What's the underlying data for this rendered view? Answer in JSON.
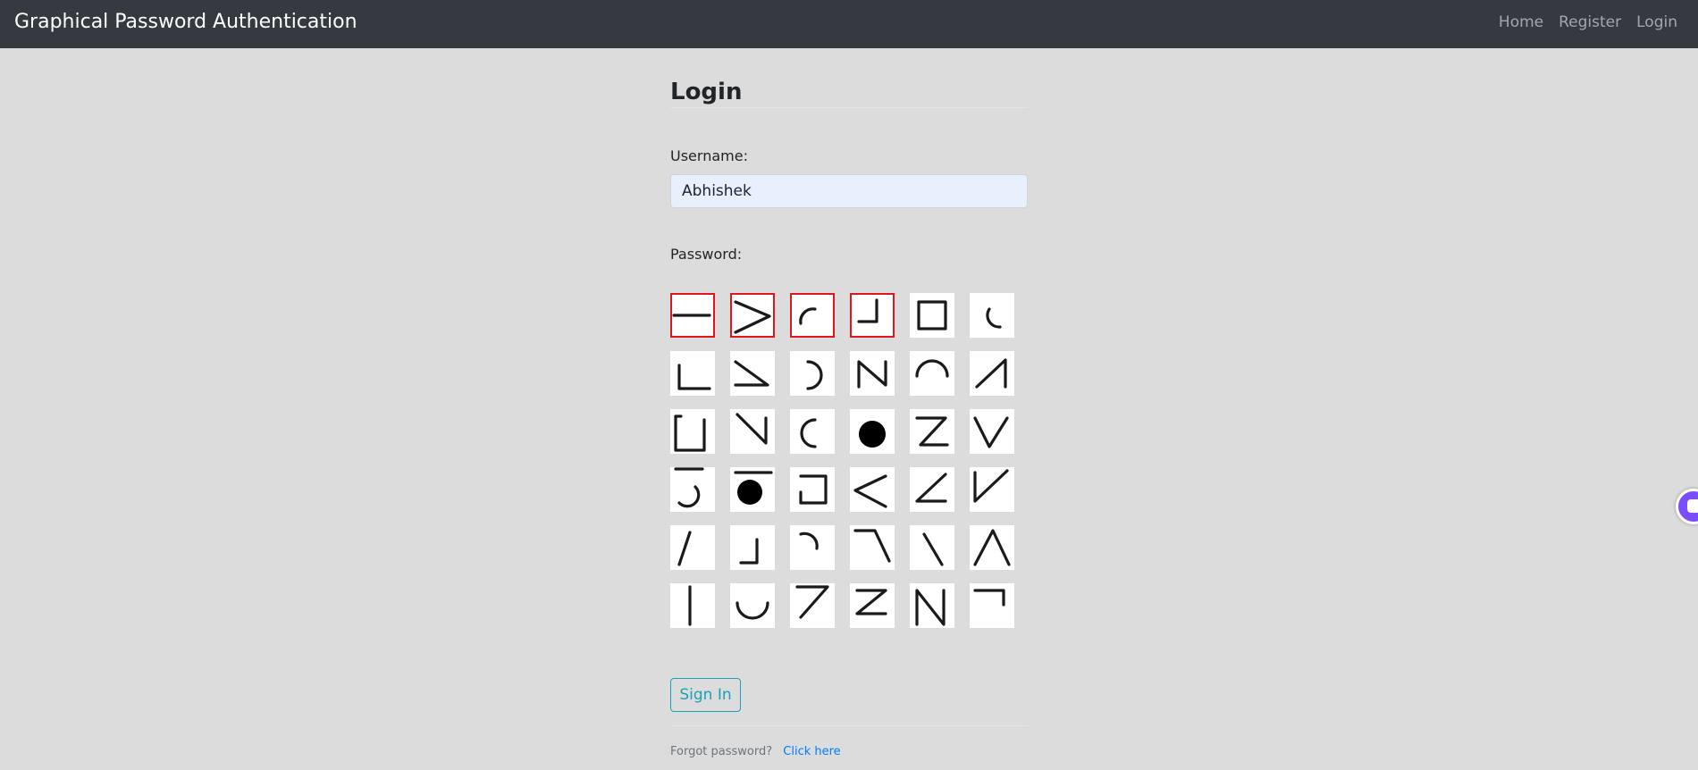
{
  "navbar": {
    "brand": "Graphical Password Authentication",
    "links": [
      "Home",
      "Register",
      "Login"
    ]
  },
  "login": {
    "title": "Login",
    "username_label": "Username:",
    "username_value": "Abhishek",
    "password_label": "Password:",
    "password_grid": {
      "rows": 6,
      "cols": 6,
      "tiles": [
        {
          "symbol": "horizontal-line",
          "selected": true
        },
        {
          "symbol": "greater-than",
          "selected": true
        },
        {
          "symbol": "arc-top-left",
          "selected": true
        },
        {
          "symbol": "corner-bottom-right",
          "selected": true
        },
        {
          "symbol": "square",
          "selected": false
        },
        {
          "symbol": "arc-bottom-left",
          "selected": false
        },
        {
          "symbol": "corner-bottom-left",
          "selected": false
        },
        {
          "symbol": "triangle-down-right",
          "selected": false
        },
        {
          "symbol": "arc-right",
          "selected": false
        },
        {
          "symbol": "n-letter",
          "selected": false
        },
        {
          "symbol": "arc-top",
          "selected": false
        },
        {
          "symbol": "triangle-up-right",
          "selected": false
        },
        {
          "symbol": "open-square-left",
          "selected": false
        },
        {
          "symbol": "backslash-corner",
          "selected": false
        },
        {
          "symbol": "arc-left",
          "selected": false
        },
        {
          "symbol": "circle",
          "selected": false
        },
        {
          "symbol": "z-letter-reverse",
          "selected": false
        },
        {
          "symbol": "v-letter",
          "selected": false
        },
        {
          "symbol": "hook-bottom-right",
          "selected": false
        },
        {
          "symbol": "open-circle",
          "selected": false
        },
        {
          "symbol": "open-square-right",
          "selected": false
        },
        {
          "symbol": "less-than",
          "selected": false
        },
        {
          "symbol": "angle-bottom",
          "selected": false
        },
        {
          "symbol": "check-down-left",
          "selected": false
        },
        {
          "symbol": "slash",
          "selected": false
        },
        {
          "symbol": "corner-right",
          "selected": false
        },
        {
          "symbol": "hook-top-right",
          "selected": false
        },
        {
          "symbol": "angle-top-left",
          "selected": false
        },
        {
          "symbol": "backslash",
          "selected": false
        },
        {
          "symbol": "lambda",
          "selected": false
        },
        {
          "symbol": "vertical-line",
          "selected": false
        },
        {
          "symbol": "cup",
          "selected": false
        },
        {
          "symbol": "seven",
          "selected": false
        },
        {
          "symbol": "z-letter",
          "selected": false
        },
        {
          "symbol": "n-letter-full",
          "selected": false
        },
        {
          "symbol": "corner-top-right",
          "selected": false
        }
      ]
    },
    "sign_in_label": "Sign In",
    "forgot_text": "Forgot password?",
    "forgot_link": "Click here"
  },
  "colors": {
    "navbar_bg": "#343a40",
    "page_bg": "#dcdcdc",
    "selected_border": "#e0161c",
    "button_accent": "#17a2b8",
    "link": "#007bff",
    "chat_widget": "#7c4dff"
  },
  "icons": {
    "chat_widget": "chat-bubble-icon"
  }
}
